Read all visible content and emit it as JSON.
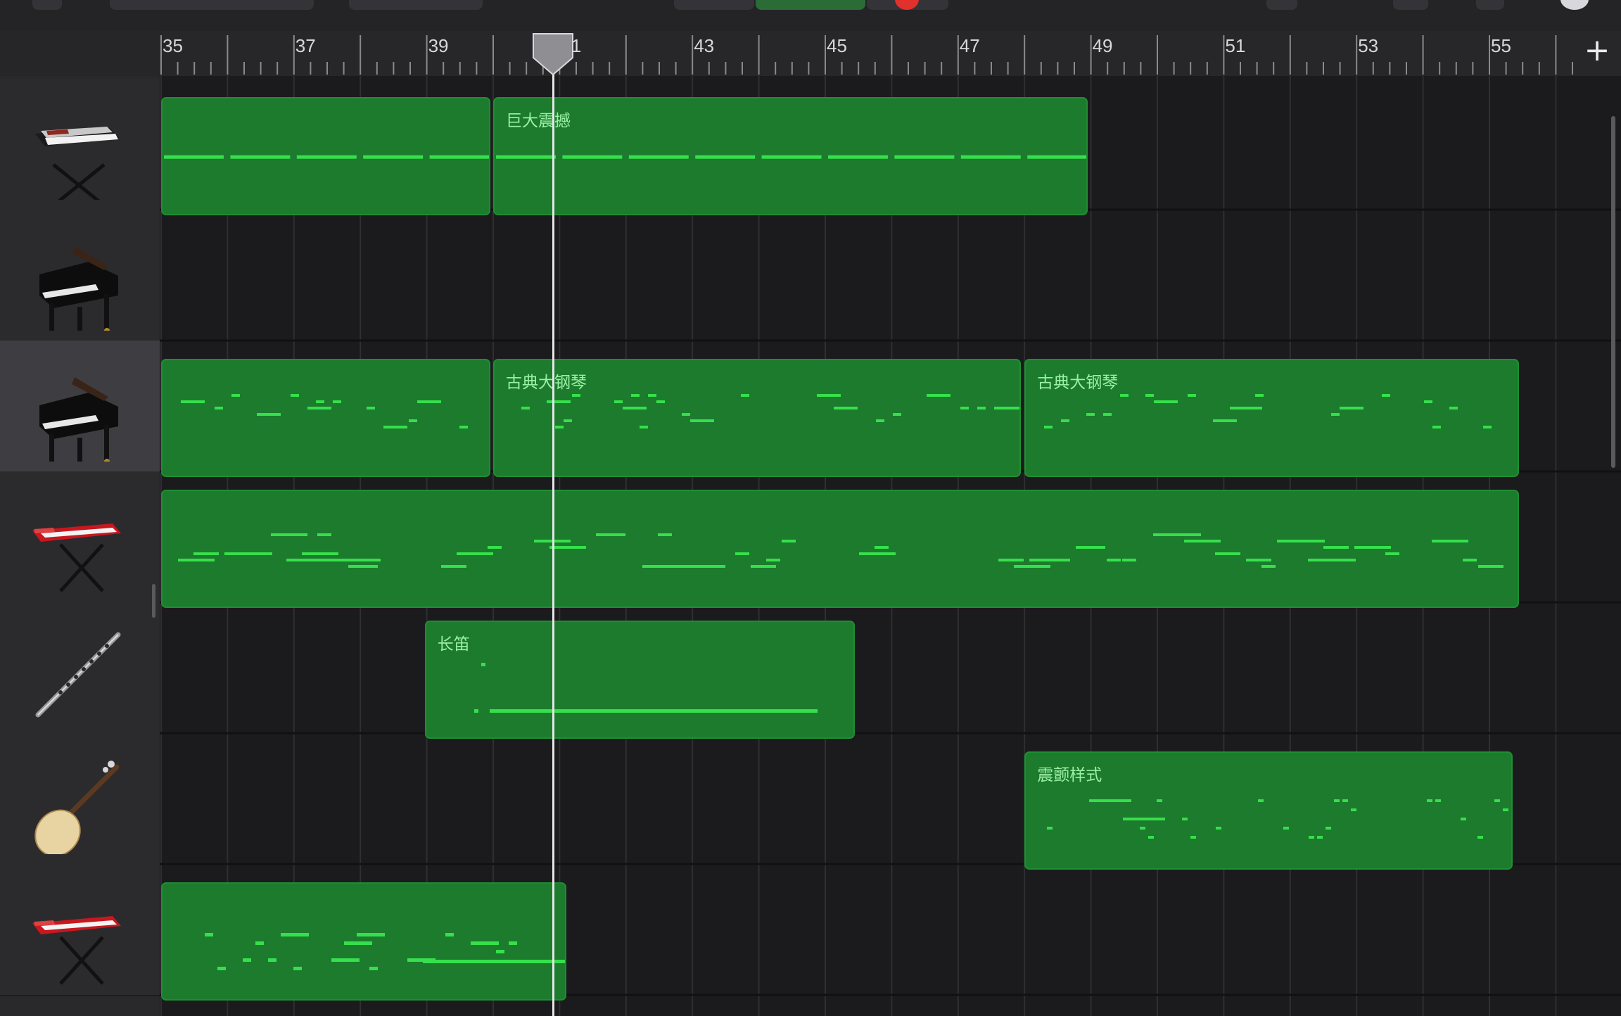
{
  "ruler": {
    "bar_labels": [
      "35",
      "37",
      "39",
      "41",
      "43",
      "45",
      "47",
      "49",
      "51",
      "53",
      "55"
    ]
  },
  "toolbar": {
    "add_track_label": "+"
  },
  "tracks": [
    {
      "instrument": "synth-keyboard",
      "regions": [
        {
          "label": ""
        },
        {
          "label": "巨大震撼"
        }
      ]
    },
    {
      "instrument": "grand-piano",
      "regions": []
    },
    {
      "instrument": "grand-piano",
      "selected": true,
      "regions": [
        {
          "label": ""
        },
        {
          "label": "古典大钢琴"
        },
        {
          "label": "古典大钢琴"
        }
      ]
    },
    {
      "instrument": "red-stage-keyboard",
      "regions": [
        {
          "label": ""
        }
      ]
    },
    {
      "instrument": "flute",
      "regions": [
        {
          "label": "长笛"
        }
      ]
    },
    {
      "instrument": "pipa",
      "regions": [
        {
          "label": "震颤样式"
        }
      ]
    },
    {
      "instrument": "red-stage-keyboard",
      "regions": [
        {
          "label": ""
        }
      ]
    }
  ],
  "playhead": {
    "bar": 40.9
  },
  "colors": {
    "region_fill": "#1c7b2d",
    "note": "#36e04c",
    "label": "#9cf0a6"
  }
}
